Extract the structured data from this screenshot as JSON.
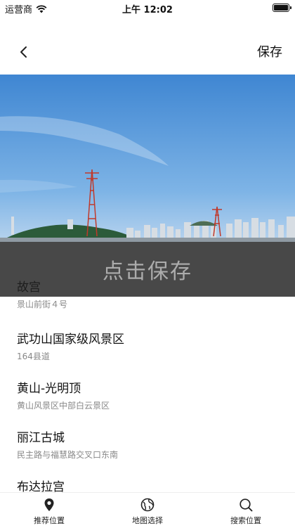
{
  "status_bar": {
    "carrier": "运营商",
    "time": "上午 12:02"
  },
  "nav": {
    "save_label": "保存"
  },
  "photo": {
    "sky_color": "#4f8fd0",
    "water_color": "#8f9aa3"
  },
  "overlay": {
    "text": "点击保存"
  },
  "places": [
    {
      "name": "故宫",
      "address": "景山前街４号"
    },
    {
      "name": "武功山国家级风景区",
      "address": "164县道"
    },
    {
      "name": "黄山-光明顶",
      "address": "黄山风景区中部白云景区"
    },
    {
      "name": "丽江古城",
      "address": "民主路与福慧路交叉口东南"
    },
    {
      "name": "布达拉宫",
      "address": ""
    }
  ],
  "tabs": [
    {
      "label": "推荐位置",
      "icon": "location-pin-icon"
    },
    {
      "label": "地图选择",
      "icon": "globe-icon"
    },
    {
      "label": "搜索位置",
      "icon": "search-icon"
    }
  ]
}
